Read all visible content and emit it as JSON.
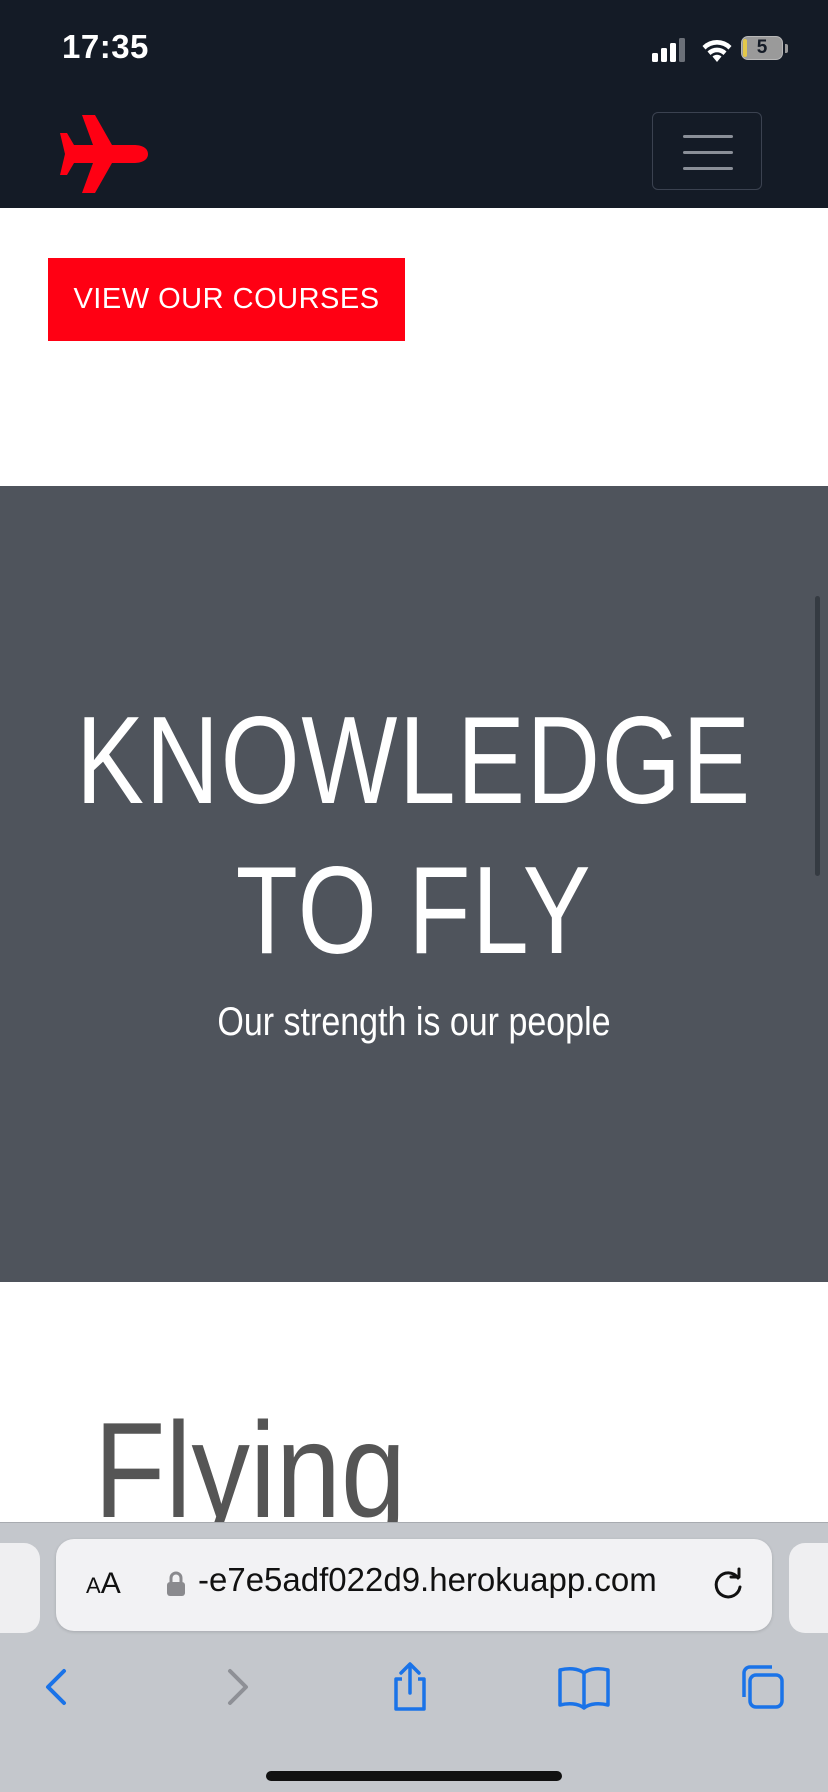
{
  "status_bar": {
    "time": "17:35",
    "battery": "5"
  },
  "navbar": {
    "logo": "airplane-logo",
    "menu_icon": "hamburger-icon"
  },
  "cta": {
    "label": "VIEW OUR COURSES"
  },
  "hero": {
    "title_line1": "KNOWLEDGE",
    "title_line2": "TO FLY",
    "subtitle": "Our strength is our people"
  },
  "flying": {
    "title": "Flying"
  },
  "browser": {
    "text_size_label_small": "A",
    "text_size_label_large": "A",
    "url": "-e7e5adf022d9.herokuapp.com",
    "toolbar_icons": [
      "back-icon",
      "forward-icon",
      "share-icon",
      "bookmarks-icon",
      "tabs-icon"
    ]
  },
  "colors": {
    "nav_bg": "#141b26",
    "accent_red": "#ff0013",
    "hero_bg": "#4f545c",
    "link_blue": "#1a73e8"
  }
}
